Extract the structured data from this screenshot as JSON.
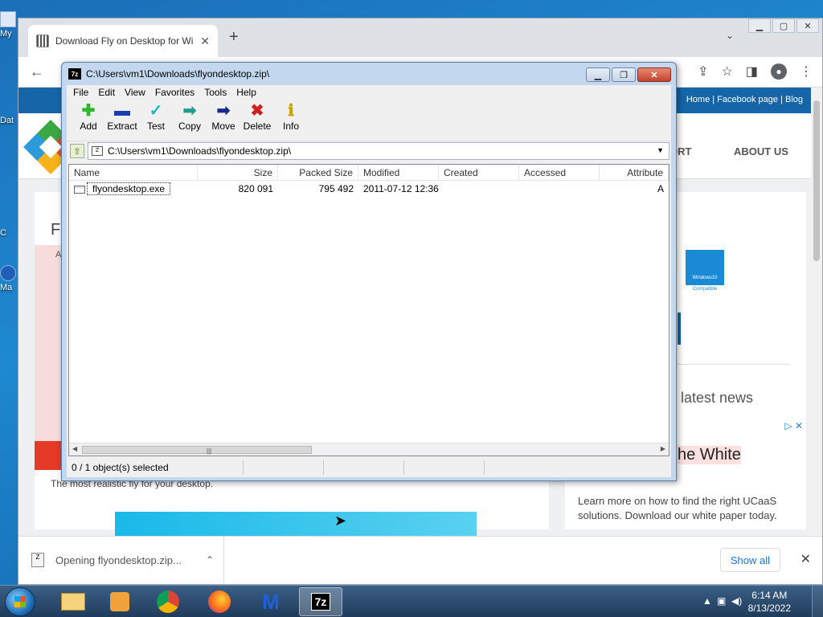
{
  "desktop": {
    "icons": [
      "My",
      "Dat",
      "C",
      "Ma"
    ]
  },
  "browser": {
    "tab_title": "Download Fly on Desktop for Wi",
    "site": {
      "toplinks": "Home | Facebook page | Blog",
      "nav": [
        "ORT",
        "ABOUT US"
      ],
      "heading_fragment": "Fl",
      "small_text": "A",
      "description": "The most realistic fly for your desktop.",
      "win10_badge": "Windows10",
      "win10_caption": "Compatible",
      "latest_news": "latest news",
      "ad_title": "he White",
      "ad_text": "Learn more on how to find the right UCaaS solutions. Download our white paper today."
    },
    "downloads": {
      "item_label": "Opening flyondesktop.zip...",
      "show_all": "Show all"
    }
  },
  "zip": {
    "title": "C:\\Users\\vm1\\Downloads\\flyondesktop.zip\\",
    "app_icon": "7z",
    "menu": [
      "File",
      "Edit",
      "View",
      "Favorites",
      "Tools",
      "Help"
    ],
    "tools": [
      {
        "label": "Add",
        "icon": "add-icon",
        "glyph": "✚",
        "color": "#2bb82b"
      },
      {
        "label": "Extract",
        "icon": "extract-icon",
        "glyph": "▬",
        "color": "#1a3fb0"
      },
      {
        "label": "Test",
        "icon": "test-icon",
        "glyph": "✓",
        "color": "#18b8c8"
      },
      {
        "label": "Copy",
        "icon": "copy-icon",
        "glyph": "➡",
        "color": "#1f9e8e"
      },
      {
        "label": "Move",
        "icon": "move-icon",
        "glyph": "➡",
        "color": "#1a2a8a"
      },
      {
        "label": "Delete",
        "icon": "delete-icon",
        "glyph": "✖",
        "color": "#d0201c"
      },
      {
        "label": "Info",
        "icon": "info-icon",
        "glyph": "ℹ",
        "color": "#c8a400"
      }
    ],
    "address": "C:\\Users\\vm1\\Downloads\\flyondesktop.zip\\",
    "columns": [
      "Name",
      "Size",
      "Packed Size",
      "Modified",
      "Created",
      "Accessed",
      "Attribute"
    ],
    "rows": [
      {
        "name": "flyondesktop.exe",
        "size": "820 091",
        "packed": "795 492",
        "modified": "2011-07-12 12:36",
        "created": "",
        "accessed": "",
        "attr": "A"
      }
    ],
    "status": "0 / 1 object(s) selected"
  },
  "taskbar": {
    "active_app": "7z",
    "time": "6:14 AM",
    "date": "8/13/2022"
  }
}
